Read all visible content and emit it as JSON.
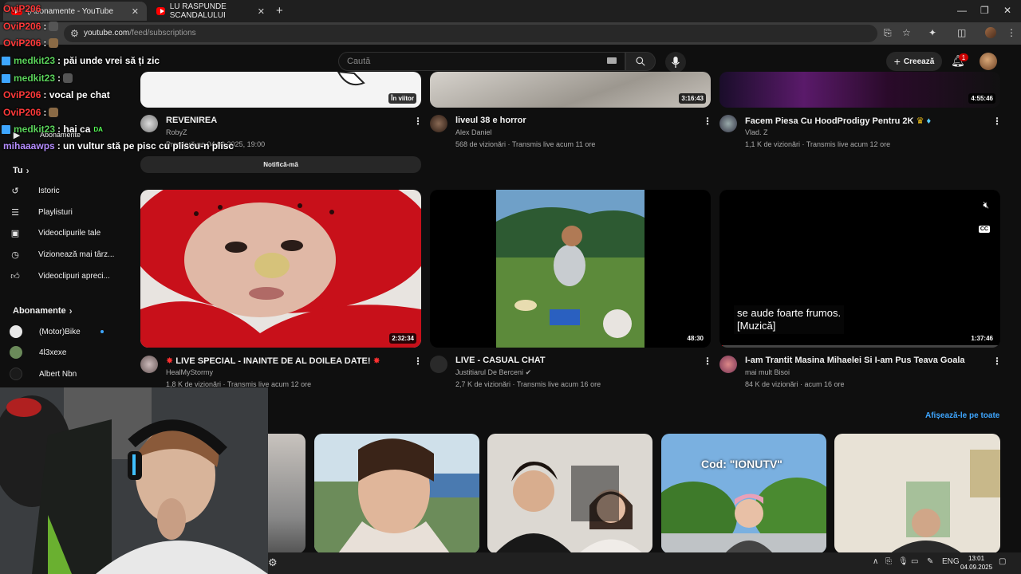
{
  "browser": {
    "tabs": [
      {
        "title": "(Abonamente - YouTube",
        "active": true
      },
      {
        "title": "LU RASPUNDE SCANDALULUI",
        "active": false
      }
    ],
    "url_host": "youtube.com",
    "url_path": "/feed/subscriptions"
  },
  "masthead": {
    "search_placeholder": "Caută",
    "create_label": "Creează",
    "notification_count": "1"
  },
  "sidebar": {
    "subscriptions_label": "Abonamente",
    "you_section": "Tu",
    "you_items": [
      {
        "label": "Istoric",
        "icon": "history-icon"
      },
      {
        "label": "Playlisturi",
        "icon": "playlist-icon"
      },
      {
        "label": "Videoclipurile tale",
        "icon": "your-videos-icon"
      },
      {
        "label": "Vizionează mai târz...",
        "icon": "watch-later-icon"
      },
      {
        "label": "Videoclipuri apreci...",
        "icon": "like-icon"
      }
    ],
    "subs_section": "Abonamente",
    "channels": [
      {
        "label": "(Motor)Bike",
        "new": true
      },
      {
        "label": "4l3xexe",
        "new": false
      },
      {
        "label": "Albert Nbn",
        "new": false
      }
    ]
  },
  "videos_row1": [
    {
      "title": "REVENIREA",
      "channel": "RobyZ",
      "meta": "Premieră pe 04.09.2025, 19:00",
      "badge": "În viitor"
    },
    {
      "title": "liveul 38 e horror",
      "channel": "Alex Daniel",
      "meta": "568 de vizionări · Transmis live acum 11 ore",
      "duration": "3:16:43"
    },
    {
      "title": "Facem Piesa Cu HoodProdigy Pentru 2K",
      "channel": "Vlad. Z",
      "meta": "1,1 K de vizionări · Transmis live acum 12 ore",
      "duration": "4:55:46"
    }
  ],
  "notify_label": "Notifică-mă",
  "videos_row2": [
    {
      "title": "LIVE SPECIAL - INAINTE DE AL DOILEA DATE!",
      "channel": "HealMyStormy",
      "meta": "1,8 K de vizionări · Transmis live acum 12 ore",
      "duration": "2:32:34"
    },
    {
      "title": "LIVE - CASUAL CHAT",
      "channel": "Justitiarul De Berceni",
      "meta": "2,7 K de vizionări · Transmis live acum 16 ore",
      "duration": "48:30"
    },
    {
      "title": "I-am Trantit Masina Mihaelei Si I-am Pus Teava Goala",
      "channel": "mai mult Bisoi",
      "meta": "84 K de vizionări · acum 16 ore",
      "duration": "1:37:46",
      "caption": [
        "se aude foarte frumos.",
        "[Muzică]"
      ]
    }
  ],
  "shorts": {
    "show_all": "Afișează-le pe toate",
    "overlay_text": "Cod: \"IONUTV\""
  },
  "chat": [
    {
      "user": "OviP206",
      "text": "",
      "color": "#ff3a3a"
    },
    {
      "user": "OviP206",
      "text": ":",
      "color": "#ff3a3a"
    },
    {
      "user": "OviP206",
      "text": ":",
      "color": "#ff3a3a"
    },
    {
      "user": "medkit23",
      "text": ": păi unde vrei să ți zic",
      "color": "#5ad35a",
      "twitch": true
    },
    {
      "user": "medkit23",
      "text": ":",
      "color": "#5ad35a",
      "twitch": true
    },
    {
      "user": "OviP206",
      "text": ": vocal pe chat",
      "color": "#ff3a3a"
    },
    {
      "user": "OviP206",
      "text": ":",
      "color": "#ff3a3a"
    },
    {
      "user": "medkit23",
      "text": ": hai ca",
      "color": "#5ad35a",
      "twitch": true,
      "badge": "DA"
    },
    {
      "user": "mihaaawps",
      "text": ": un vultur stă pe pisc cu pliscu-n plisc",
      "color": "#b48cff"
    }
  ],
  "taskbar": {
    "lang": "ENG",
    "time": "13:01",
    "date": "04.09.2025"
  },
  "colors": {
    "accent": "#3ea6ff",
    "brand": "#ff0000",
    "bg": "#0f0f0f"
  }
}
